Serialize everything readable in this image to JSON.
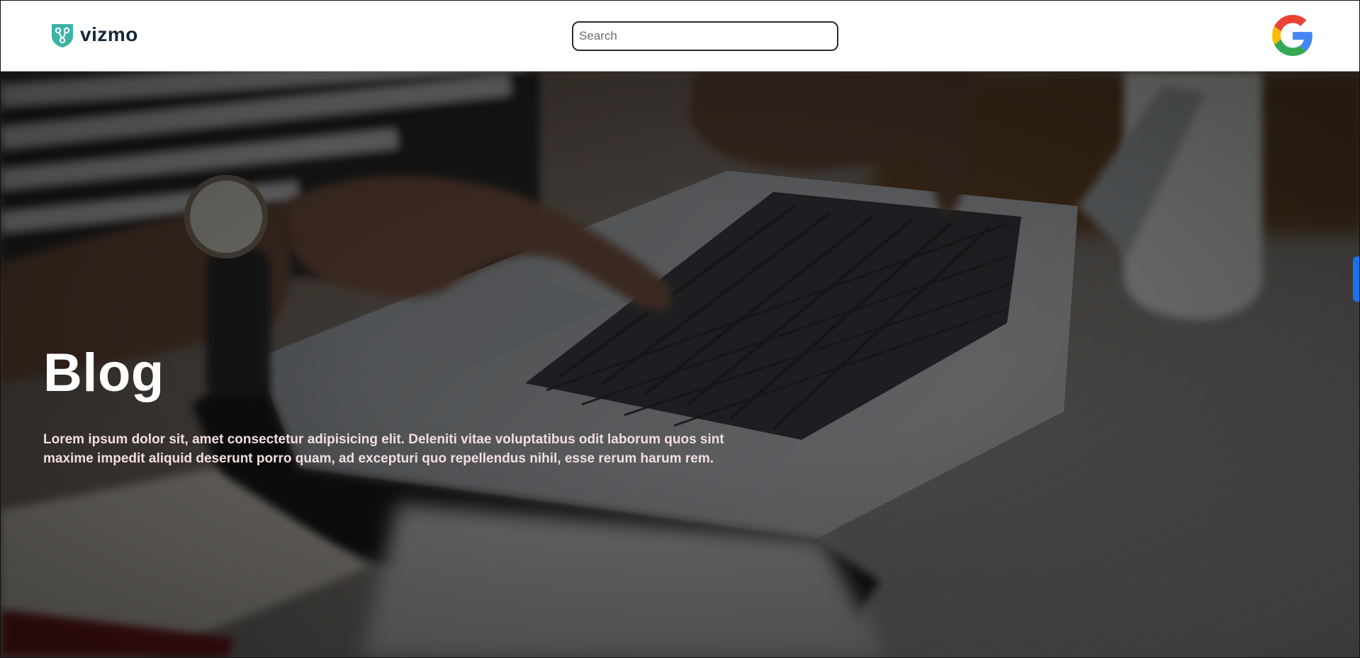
{
  "header": {
    "brand": "vizmo",
    "search": {
      "placeholder": "Search",
      "value": ""
    },
    "account_icon": "google-g-icon"
  },
  "hero": {
    "title": "Blog",
    "description": "Lorem ipsum dolor sit, amet consectetur adipisicing elit. Deleniti vitae voluptatibus odit laborum quos sint maxime impedit aliquid deserunt porro quam, ad excepturi quo repellendus nihil, esse rerum harum rem."
  },
  "colors": {
    "brand_teal": "#3bb3a6",
    "brand_text": "#12263a",
    "hero_text": "#f3dede",
    "accent_blue": "#1a73e8"
  }
}
